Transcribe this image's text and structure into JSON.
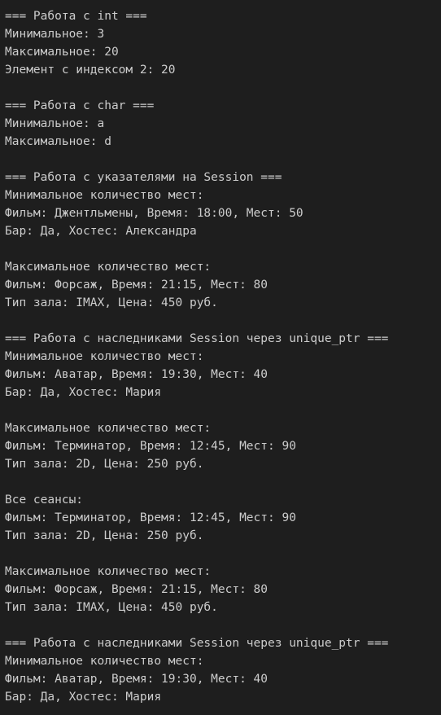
{
  "terminal": {
    "lines": [
      "=== Работа с int ===",
      "Минимальное: 3",
      "Максимальное: 20",
      "Элемент с индексом 2: 20",
      "",
      "=== Работа с char ===",
      "Минимальное: a",
      "Максимальное: d",
      "",
      "=== Работа с указателями на Session ===",
      "Минимальное количество мест:",
      "Фильм: Джентльмены, Время: 18:00, Мест: 50",
      "Бар: Да, Хостес: Александра",
      "",
      "Максимальное количество мест:",
      "Фильм: Форсаж, Время: 21:15, Мест: 80",
      "Тип зала: IMAX, Цена: 450 руб.",
      "",
      "=== Работа с наследниками Session через unique_ptr ===",
      "Минимальное количество мест:",
      "Фильм: Аватар, Время: 19:30, Мест: 40",
      "Бар: Да, Хостес: Мария",
      "",
      "Максимальное количество мест:",
      "Фильм: Терминатор, Время: 12:45, Мест: 90",
      "Тип зала: 2D, Цена: 250 руб.",
      "",
      "Все сеансы:",
      "Фильм: Терминатор, Время: 12:45, Мест: 90",
      "Тип зала: 2D, Цена: 250 руб.",
      "",
      "Максимальное количество мест:",
      "Фильм: Форсаж, Время: 21:15, Мест: 80",
      "Тип зала: IMAX, Цена: 450 руб.",
      "",
      "=== Работа с наследниками Session через unique_ptr ===",
      "Минимальное количество мест:",
      "Фильм: Аватар, Время: 19:30, Мест: 40",
      "Бар: Да, Хостес: Мария"
    ]
  }
}
